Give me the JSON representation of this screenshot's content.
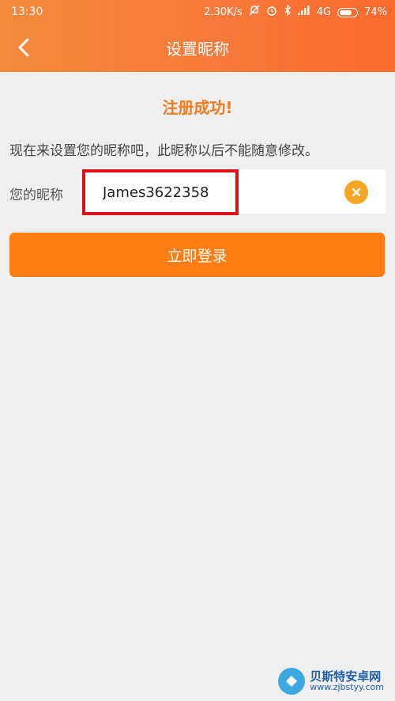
{
  "status_bar": {
    "time": "13:30",
    "network_speed": "2.30K/s",
    "network_type": "4G",
    "battery_percent": "74%",
    "battery_level": 0.74,
    "icons": [
      "mute-icon",
      "alarm-icon",
      "bluetooth-icon",
      "signal-icon",
      "battery-icon"
    ]
  },
  "navbar": {
    "title": "设置昵称",
    "back_icon": "chevron-left-icon"
  },
  "main": {
    "success_title": "注册成功!",
    "description": "现在来设置您的昵称吧，此昵称以后不能随意修改。",
    "nickname_label": "您的昵称",
    "nickname_value": "James3622358",
    "clear_icon": "clear-circle-icon",
    "login_button_label": "立即登录"
  },
  "watermark": {
    "name": "贝斯特安卓网",
    "url": "www.zjbstyy.com"
  },
  "colors": {
    "header_gradient_start": "#f48a3c",
    "header_gradient_end": "#fb6a2e",
    "accent_orange": "#ff7d12",
    "success_title": "#f07a1e",
    "highlight_border": "#d9121a",
    "clear_button": "#f5a623",
    "background": "#efefef"
  }
}
